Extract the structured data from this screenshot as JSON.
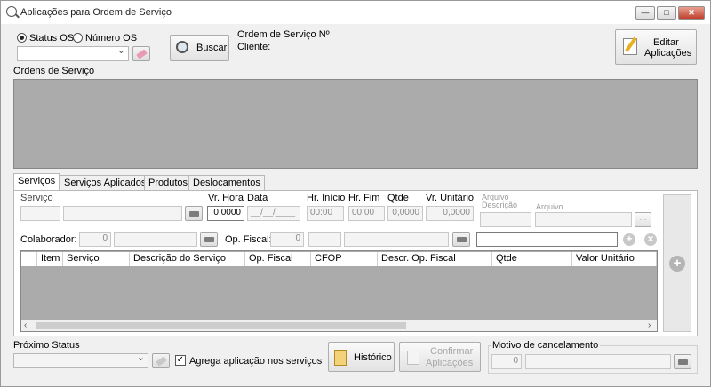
{
  "window": {
    "title": "Aplicações para Ordem de Serviço",
    "minimize": "—",
    "maximize": "□",
    "close": "✕"
  },
  "search": {
    "radio_status": "Status OS",
    "radio_numero": "Número OS",
    "buscar": "Buscar"
  },
  "os_info": {
    "ordem_label": "Ordem de Serviço Nº",
    "cliente_label": "Cliente:"
  },
  "editar": {
    "line1": "Editar",
    "line2": "Aplicações"
  },
  "ordens_label": "Ordens de Serviço",
  "tabs": [
    "Serviços",
    "Serviços Aplicados",
    "Produtos",
    "Deslocamentos"
  ],
  "servicos": {
    "servico_label": "Serviço",
    "vr_hora_label": "Vr. Hora",
    "vr_hora_value": "0,0000",
    "data_label": "Data",
    "data_value": "__/__/____",
    "hr_inicio_label": "Hr. Início",
    "hr_inicio_value": "00:00",
    "hr_fim_label": "Hr. Fim",
    "hr_fim_value": "00:00",
    "qtde_label": "Qtde",
    "qtde_value": "0,0000",
    "vr_unitario_label": "Vr. Unitário",
    "vr_unitario_value": "0,0000",
    "arquivo_group": "Arquivo",
    "descricao_label": "Descrição",
    "arquivo_label": "Arquivo",
    "browse": "...",
    "colaborador_label": "Colaborador:",
    "colaborador_value": "0",
    "op_fiscal_label": "Op. Fiscal:",
    "op_fiscal_value": "0"
  },
  "grid_columns": [
    "Item",
    "Serviço",
    "Descrição do Serviço",
    "Op. Fiscal",
    "CFOP",
    "Descr. Op. Fiscal",
    "Qtde",
    "Valor Unitário"
  ],
  "footer": {
    "proximo_status_label": "Próximo Status",
    "agrega_label": "Agrega aplicação nos serviços",
    "historico": "Histórico",
    "confirmar_line1": "Confirmar",
    "confirmar_line2": "Aplicações",
    "motivo_label": "Motivo de cancelamento",
    "motivo_value": "0"
  }
}
